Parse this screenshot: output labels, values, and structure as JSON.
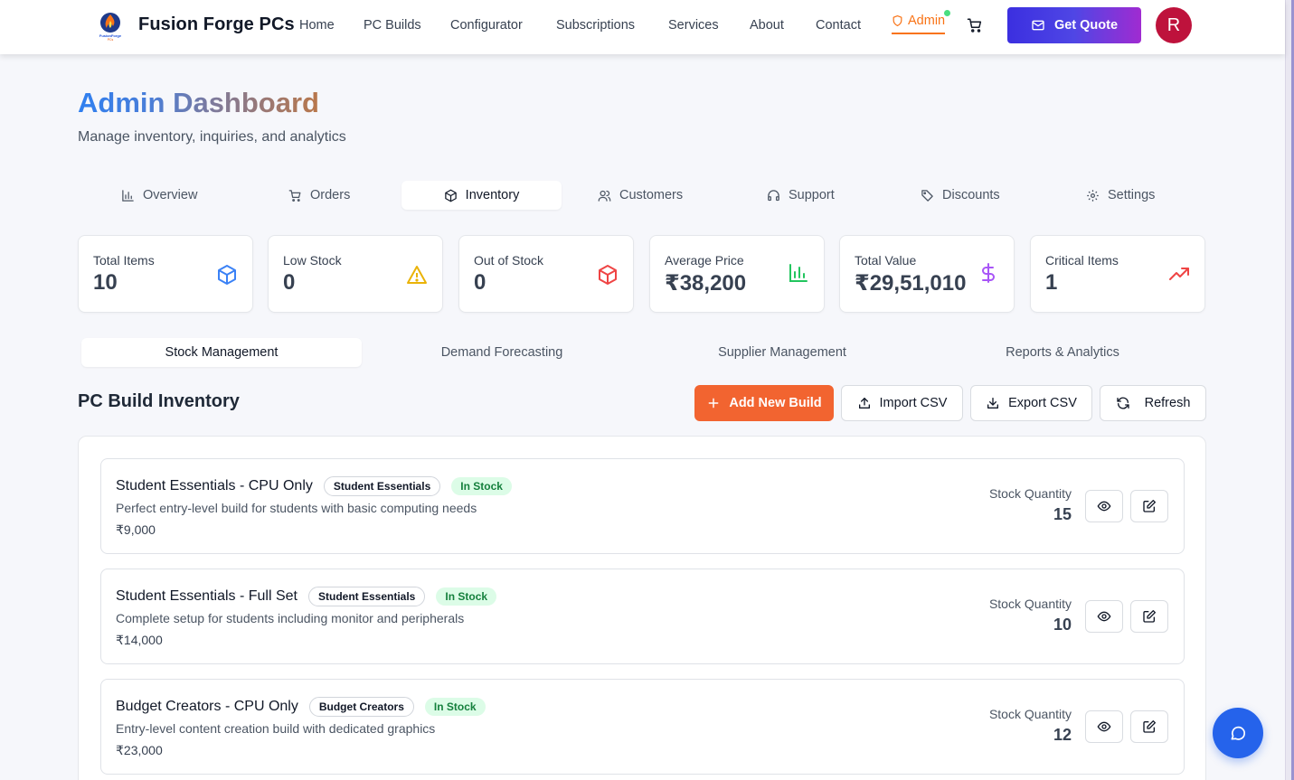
{
  "header": {
    "brand": "Fusion Forge PCs",
    "logo_text": "FusionForge PCs",
    "nav": [
      "Home",
      "PC Builds",
      "Configurator",
      "Subscriptions",
      "Services",
      "About",
      "Contact"
    ],
    "admin_label": "Admin",
    "quote_label": "Get Quote",
    "avatar_initial": "R"
  },
  "page": {
    "title_a": "Admin",
    "title_b": "Dashboard",
    "subtitle": "Manage inventory, inquiries, and analytics"
  },
  "main_tabs": [
    {
      "label": "Overview",
      "icon": "bar-chart-icon"
    },
    {
      "label": "Orders",
      "icon": "cart-icon"
    },
    {
      "label": "Inventory",
      "icon": "package-icon",
      "active": true
    },
    {
      "label": "Customers",
      "icon": "users-icon"
    },
    {
      "label": "Support",
      "icon": "headphones-icon"
    },
    {
      "label": "Discounts",
      "icon": "tag-icon"
    },
    {
      "label": "Settings",
      "icon": "gear-icon"
    }
  ],
  "stats": [
    {
      "label": "Total Items",
      "value": "10",
      "icon": "package-icon",
      "color": "#3b82f6"
    },
    {
      "label": "Low Stock",
      "value": "0",
      "icon": "warning-icon",
      "color": "#eab308"
    },
    {
      "label": "Out of Stock",
      "value": "0",
      "icon": "package-icon",
      "color": "#ef4444"
    },
    {
      "label": "Average Price",
      "value": "₹38,200",
      "icon": "bar-chart-icon",
      "color": "#22c55e"
    },
    {
      "label": "Total Value",
      "value": "₹29,51,010",
      "icon": "dollar-icon",
      "color": "#a855f7"
    },
    {
      "label": "Critical Items",
      "value": "1",
      "icon": "trending-up-icon",
      "color": "#ef4444"
    }
  ],
  "sub_tabs": [
    "Stock Management",
    "Demand Forecasting",
    "Supplier Management",
    "Reports & Analytics"
  ],
  "section": {
    "title": "PC Build Inventory",
    "add_label": "Add New Build",
    "import_label": "Import CSV",
    "export_label": "Export CSV",
    "refresh_label": "Refresh"
  },
  "items": [
    {
      "name": "Student Essentials - CPU Only",
      "category": "Student Essentials",
      "status": "In Stock",
      "description": "Perfect entry-level build for students with basic computing needs",
      "price": "₹9,000",
      "qty_label": "Stock Quantity",
      "qty": "15"
    },
    {
      "name": "Student Essentials - Full Set",
      "category": "Student Essentials",
      "status": "In Stock",
      "description": "Complete setup for students including monitor and peripherals",
      "price": "₹14,000",
      "qty_label": "Stock Quantity",
      "qty": "10"
    },
    {
      "name": "Budget Creators - CPU Only",
      "category": "Budget Creators",
      "status": "In Stock",
      "description": "Entry-level content creation build with dedicated graphics",
      "price": "₹23,000",
      "qty_label": "Stock Quantity",
      "qty": "12"
    }
  ],
  "colors": {
    "accent": "#f26430",
    "primary": "#2563eb",
    "avatar": "#be123c"
  }
}
